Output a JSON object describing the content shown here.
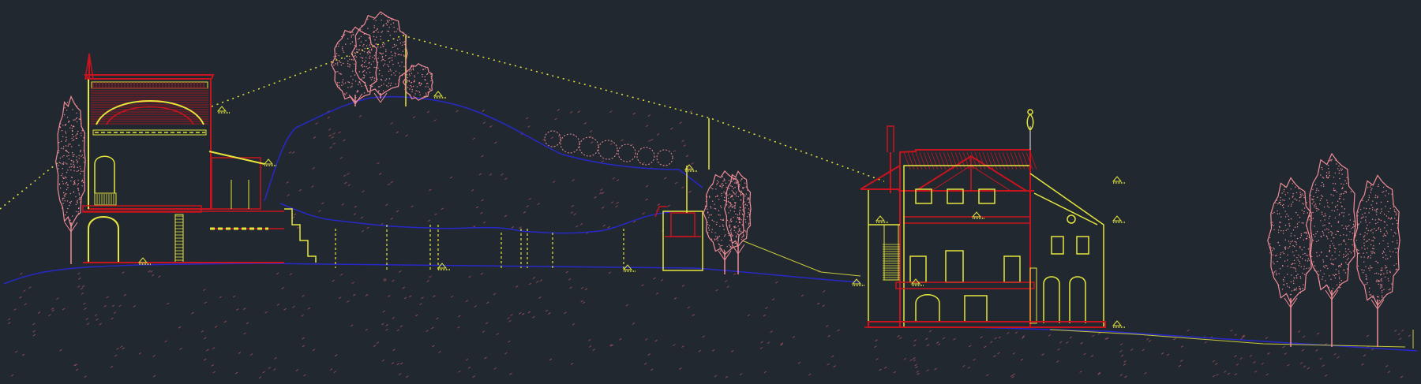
{
  "canvas": {
    "background": "#212830"
  },
  "palette": {
    "yellow": "#e6e63c",
    "red": "#c8141e",
    "pink": "#f08c96",
    "blue": "#2828c8",
    "dirt": "#a0505a",
    "olive": "#c8c83c",
    "white": "#e6e6e6"
  },
  "drawing": {
    "kind": "architectural site section",
    "layers": [
      "site-ground",
      "hill",
      "buildings",
      "vegetation",
      "sight-lines",
      "elevation-markers"
    ],
    "icons": [
      "elevation-marker-icon",
      "tree-icon",
      "statue-icon"
    ]
  }
}
